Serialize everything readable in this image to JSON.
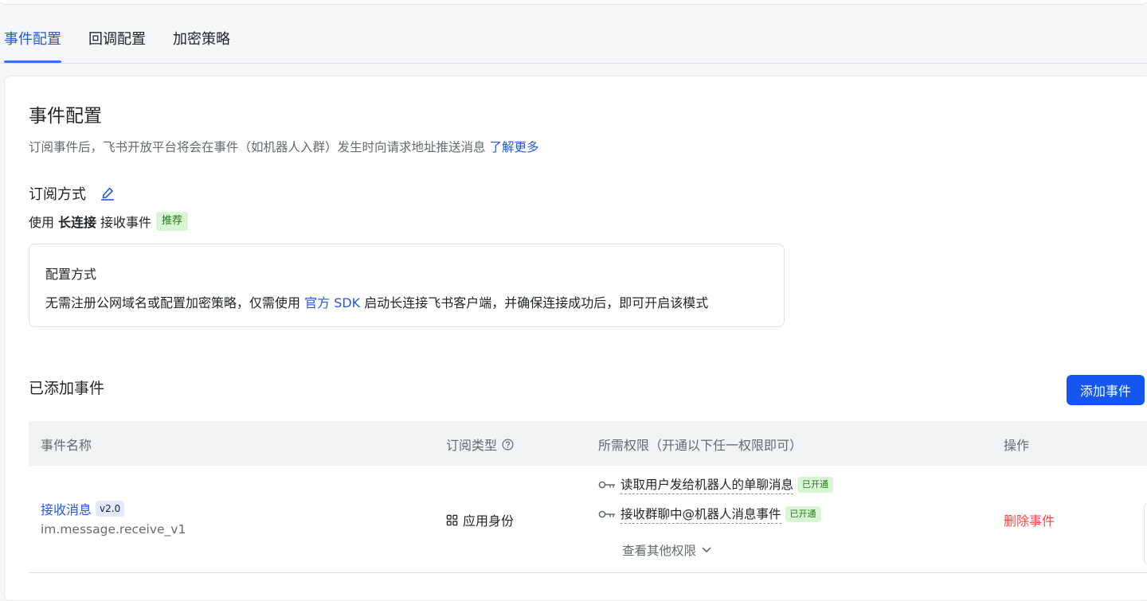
{
  "tabs": [
    {
      "label": "事件配置",
      "active": true
    },
    {
      "label": "回调配置",
      "active": false
    },
    {
      "label": "加密策略",
      "active": false
    }
  ],
  "section": {
    "title": "事件配置",
    "description": "订阅事件后，飞书开放平台将会在事件（如机器人入群）发生时向请求地址推送消息",
    "learn_more": "了解更多"
  },
  "subscription": {
    "title": "订阅方式",
    "edit_icon": "edit-icon",
    "prefix": "使用",
    "mode": "长连接",
    "suffix": "接收事件",
    "badge": "推荐"
  },
  "config_box": {
    "title": "配置方式",
    "text_before": "无需注册公网域名或配置加密策略，仅需使用",
    "link": "官方 SDK",
    "text_after": "启动长连接飞书客户端，并确保连接成功后，即可开启该模式"
  },
  "events": {
    "title": "已添加事件",
    "add_button": "添加事件",
    "columns": [
      "事件名称",
      "订阅类型",
      "所需权限（开通以下任一权限即可）",
      "操作"
    ],
    "rows": [
      {
        "name": "接收消息",
        "version": "v2.0",
        "id": "im.message.receive_v1",
        "sub_type": "应用身份",
        "permissions": [
          {
            "label": "读取用户发给机器人的单聊消息",
            "status": "已开通"
          },
          {
            "label": "接收群聊中@机器人消息事件",
            "status": "已开通"
          }
        ],
        "more_permissions": "查看其他权限",
        "action": "删除事件"
      }
    ]
  },
  "colors": {
    "primary": "#1456f0",
    "link": "#245bdb",
    "danger": "#f54a45",
    "success_bg": "#d9f5d6",
    "success_text": "#237b19"
  }
}
